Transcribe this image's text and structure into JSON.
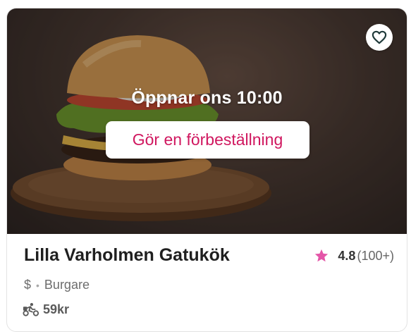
{
  "restaurant": {
    "status_text": "Öppnar ons 10:00",
    "preorder_label": "Gör en förbeställning",
    "name": "Lilla Varholmen Gatukök",
    "rating": "4.8",
    "rating_count": "(100+)",
    "price_level": "$",
    "separator": "•",
    "cuisine": "Burgare",
    "delivery_fee": "59kr"
  },
  "icons": {
    "favorite": "heart-outline-icon",
    "rating": "star-icon",
    "delivery": "bike-courier-icon"
  },
  "colors": {
    "accent": "#d0175f",
    "star": "#e456a8"
  }
}
